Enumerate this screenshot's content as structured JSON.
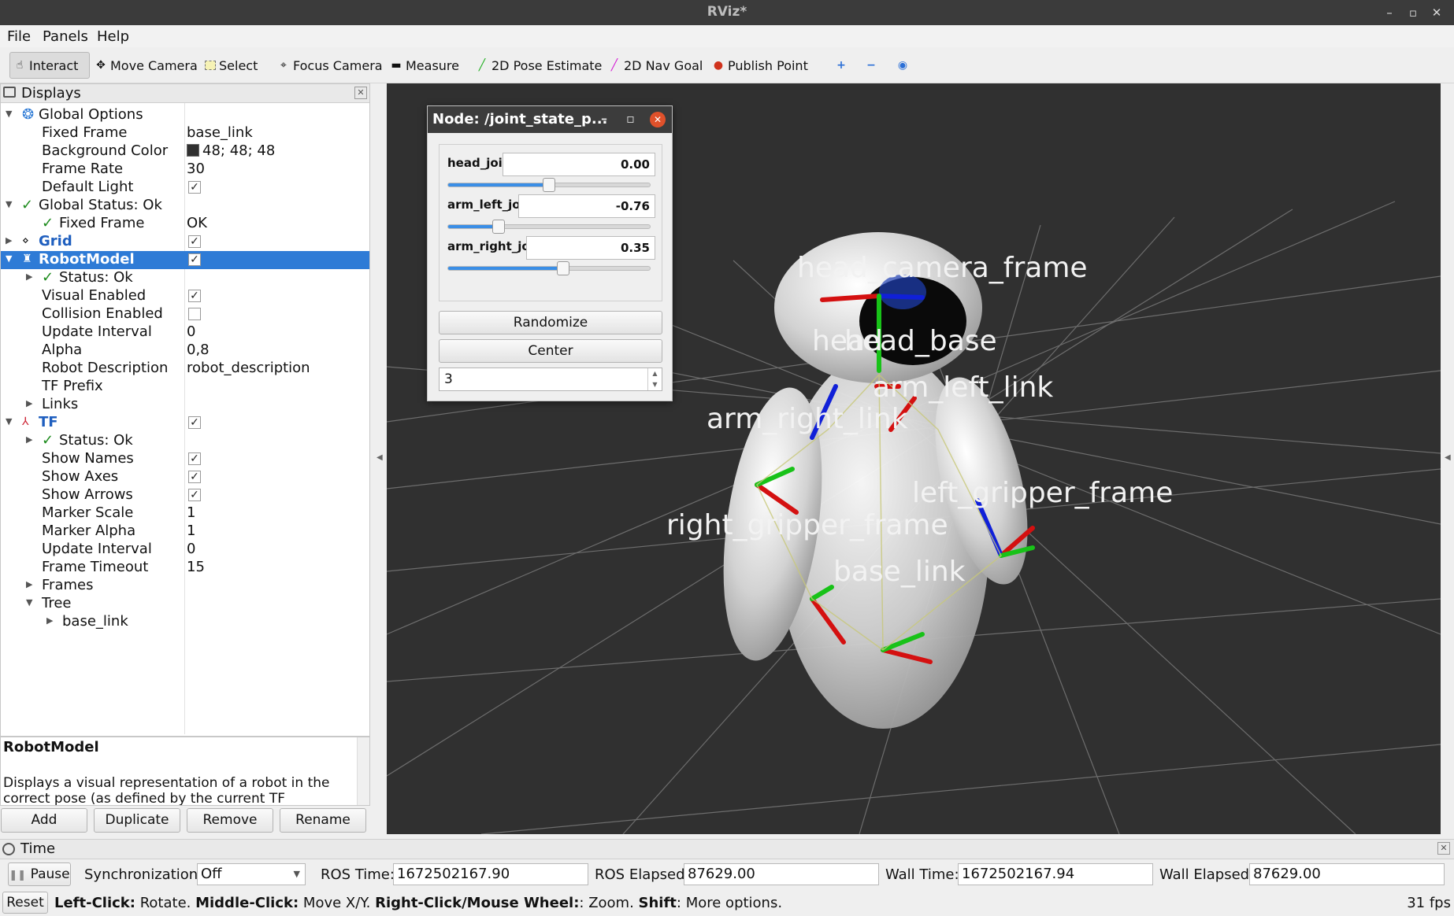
{
  "window": {
    "title": "RViz*"
  },
  "menu": [
    "File",
    "Panels",
    "Help"
  ],
  "toolbar": {
    "interact": "Interact",
    "move_camera": "Move Camera",
    "select": "Select",
    "focus_camera": "Focus Camera",
    "measure": "Measure",
    "pose_estimate": "2D Pose Estimate",
    "nav_goal": "2D Nav Goal",
    "publish_point": "Publish Point"
  },
  "displays": {
    "title": "Displays",
    "rows": [
      {
        "name": "Global Options",
        "value": ""
      },
      {
        "name": "Fixed Frame",
        "value": "base_link"
      },
      {
        "name": "Background Color",
        "value": "48; 48; 48"
      },
      {
        "name": "Frame Rate",
        "value": "30"
      },
      {
        "name": "Default Light",
        "value": ""
      },
      {
        "name": "Global Status: Ok",
        "value": ""
      },
      {
        "name": "Fixed Frame",
        "value": "OK"
      },
      {
        "name": "Grid",
        "value": ""
      },
      {
        "name": "RobotModel",
        "value": ""
      },
      {
        "name": "Status: Ok",
        "value": ""
      },
      {
        "name": "Visual Enabled",
        "value": ""
      },
      {
        "name": "Collision Enabled",
        "value": ""
      },
      {
        "name": "Update Interval",
        "value": "0"
      },
      {
        "name": "Alpha",
        "value": "0,8"
      },
      {
        "name": "Robot Description",
        "value": "robot_description"
      },
      {
        "name": "TF Prefix",
        "value": ""
      },
      {
        "name": "Links",
        "value": ""
      },
      {
        "name": "TF",
        "value": ""
      },
      {
        "name": "Status: Ok",
        "value": ""
      },
      {
        "name": "Show Names",
        "value": ""
      },
      {
        "name": "Show Axes",
        "value": ""
      },
      {
        "name": "Show Arrows",
        "value": ""
      },
      {
        "name": "Marker Scale",
        "value": "1"
      },
      {
        "name": "Marker Alpha",
        "value": "1"
      },
      {
        "name": "Update Interval",
        "value": "0"
      },
      {
        "name": "Frame Timeout",
        "value": "15"
      },
      {
        "name": "Frames",
        "value": ""
      },
      {
        "name": "Tree",
        "value": ""
      },
      {
        "name": "base_link",
        "value": ""
      }
    ],
    "background_color": "#303030"
  },
  "description": {
    "title": "RobotModel",
    "text": "Displays a visual representation of a robot in the correct pose (as defined by the current TF"
  },
  "panel_buttons": {
    "add": "Add",
    "duplicate": "Duplicate",
    "remove": "Remove",
    "rename": "Rename"
  },
  "joint_panel": {
    "title": "Node: /joint_state_p...",
    "joints": [
      {
        "name": "head_joint",
        "value": "0.00",
        "position": 0.5
      },
      {
        "name": "arm_left_joint",
        "value": "-0.76",
        "position": 0.25
      },
      {
        "name": "arm_right_joint",
        "value": "0.35",
        "position": 0.57
      }
    ],
    "randomize": "Randomize",
    "center": "Center",
    "spin_value": "3"
  },
  "viewport_labels": {
    "head_camera_frame": "head_camera_frame",
    "head_base": "head_base",
    "head": "head",
    "arm_left_link": "arm_left_link",
    "arm_right_link": "arm_right_link",
    "left_gripper_frame": "left_gripper_frame",
    "right_gripper_frame": "right_gripper_frame",
    "base_link": "base_link"
  },
  "time": {
    "title": "Time",
    "pause": "Pause",
    "sync_label": "Synchronization:",
    "sync_value": "Off",
    "ros_time_label": "ROS Time:",
    "ros_time": "1672502167.90",
    "ros_elapsed_label": "ROS Elapsed:",
    "ros_elapsed": "87629.00",
    "wall_time_label": "Wall Time:",
    "wall_time": "1672502167.94",
    "wall_elapsed_label": "Wall Elapsed:",
    "wall_elapsed": "87629.00"
  },
  "status": {
    "reset": "Reset",
    "k1": "Left-Click:",
    "v1": " Rotate. ",
    "k2": "Middle-Click:",
    "v2": " Move X/Y. ",
    "k3": "Right-Click/Mouse Wheel:",
    "v3": ": Zoom. ",
    "k4": "Shift",
    "v4": ": More options.",
    "fps": "31 fps"
  },
  "icons": [
    "minimize-icon",
    "maximize-icon",
    "close-icon",
    "interact-icon",
    "move-camera-icon",
    "select-icon",
    "focus-camera-icon",
    "measure-icon",
    "pose-estimate-icon",
    "nav-goal-icon",
    "publish-point-icon",
    "zoom-in-icon",
    "zoom-out-icon",
    "camera-view-icon"
  ]
}
